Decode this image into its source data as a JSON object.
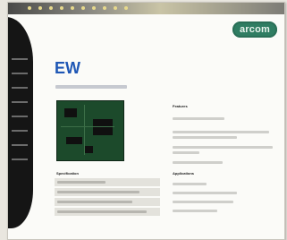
{
  "brand": {
    "logo_text": "arcom"
  },
  "product": {
    "title": "EW",
    "subtitle": ""
  },
  "sections": {
    "features_heading": "Features",
    "applications_heading": "Applications",
    "specification_heading": "Specification"
  },
  "colors": {
    "title_blue": "#1f57b5",
    "logo_green": "#2f7d62",
    "sidebar_black": "#151515",
    "board_green": "#1c4a2b"
  }
}
